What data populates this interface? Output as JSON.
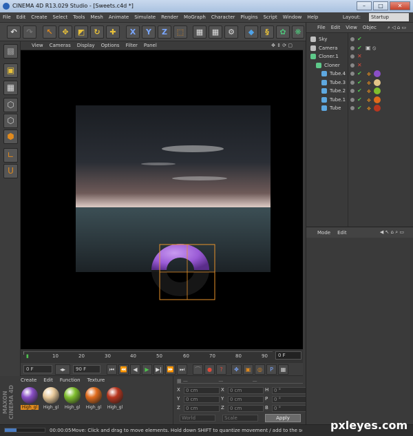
{
  "window": {
    "title": "CINEMA 4D R13.029 Studio - [Sweets.c4d *]",
    "buttons": [
      "–",
      "□",
      "✕"
    ]
  },
  "menu": [
    "File",
    "Edit",
    "Create",
    "Select",
    "Tools",
    "Mesh",
    "Animate",
    "Simulate",
    "Render",
    "MoGraph",
    "Character",
    "Plugins",
    "Script",
    "Window",
    "Help"
  ],
  "layout": {
    "label": "Layout:",
    "value": "Startup"
  },
  "viewport_menu": [
    "View",
    "Cameras",
    "Display",
    "Options",
    "Filter",
    "Panel"
  ],
  "object_manager": {
    "menu": [
      "File",
      "Edit",
      "View",
      "Objec"
    ],
    "objects": [
      {
        "name": "Sky",
        "indent": 0,
        "tag": "none"
      },
      {
        "name": "Camera",
        "indent": 0,
        "tag": "camera"
      },
      {
        "name": "Cloner.1",
        "indent": 0,
        "tag": "none"
      },
      {
        "name": "Cloner",
        "indent": 1,
        "tag": "none"
      },
      {
        "name": "Tube.4",
        "indent": 2,
        "mat": "#8a4fc7"
      },
      {
        "name": "Tube.3",
        "indent": 2,
        "mat": "#e3c488"
      },
      {
        "name": "Tube.2",
        "indent": 2,
        "mat": "#7fbe2e"
      },
      {
        "name": "Tube.1",
        "indent": 2,
        "mat": "#e06b1c"
      },
      {
        "name": "Tube",
        "indent": 2,
        "mat": "#b8361f"
      }
    ]
  },
  "attribute_manager": {
    "menu": [
      "Mode",
      "Edit"
    ]
  },
  "timeline": {
    "ticks": [
      "0",
      "10",
      "20",
      "30",
      "40",
      "50",
      "60",
      "70",
      "80",
      "90"
    ],
    "current_frame": "0 F"
  },
  "transport": {
    "start": "0 F",
    "end": "90 F"
  },
  "materials": {
    "menu": [
      "Create",
      "Edit",
      "Function",
      "Texture"
    ],
    "items": [
      {
        "label": "High_gl",
        "color": "#8a4fc7",
        "selected": true
      },
      {
        "label": "High_gl",
        "color": "#e8c99a",
        "selected": false
      },
      {
        "label": "High_gl",
        "color": "#7fbe2e",
        "selected": false
      },
      {
        "label": "High_gl",
        "color": "#e06b1c",
        "selected": false
      },
      {
        "label": "High_gl",
        "color": "#b8361f",
        "selected": false
      }
    ]
  },
  "coordinates": {
    "rows": [
      {
        "a": "X",
        "av": "0 cm",
        "b": "X",
        "bv": "0 cm",
        "c": "H",
        "cv": "0 °"
      },
      {
        "a": "Y",
        "av": "0 cm",
        "b": "Y",
        "bv": "0 cm",
        "c": "P",
        "cv": "0 °"
      },
      {
        "a": "Z",
        "av": "0 cm",
        "b": "Z",
        "bv": "0 cm",
        "c": "B",
        "cv": "0 °"
      }
    ],
    "world": "World",
    "scale": "Scale",
    "apply": "Apply"
  },
  "status": {
    "time": "00:00:05",
    "message": "Move: Click and drag to move elements. Hold down SHIFT to quantize movement / add to the selection i"
  },
  "branding": {
    "maxon": "MAXON CINEMA 4D"
  },
  "watermark": "pxleyes.com",
  "colors": {
    "accent": "#e08a1e",
    "bbox": "#e8922a",
    "donut": "#a062d8"
  }
}
